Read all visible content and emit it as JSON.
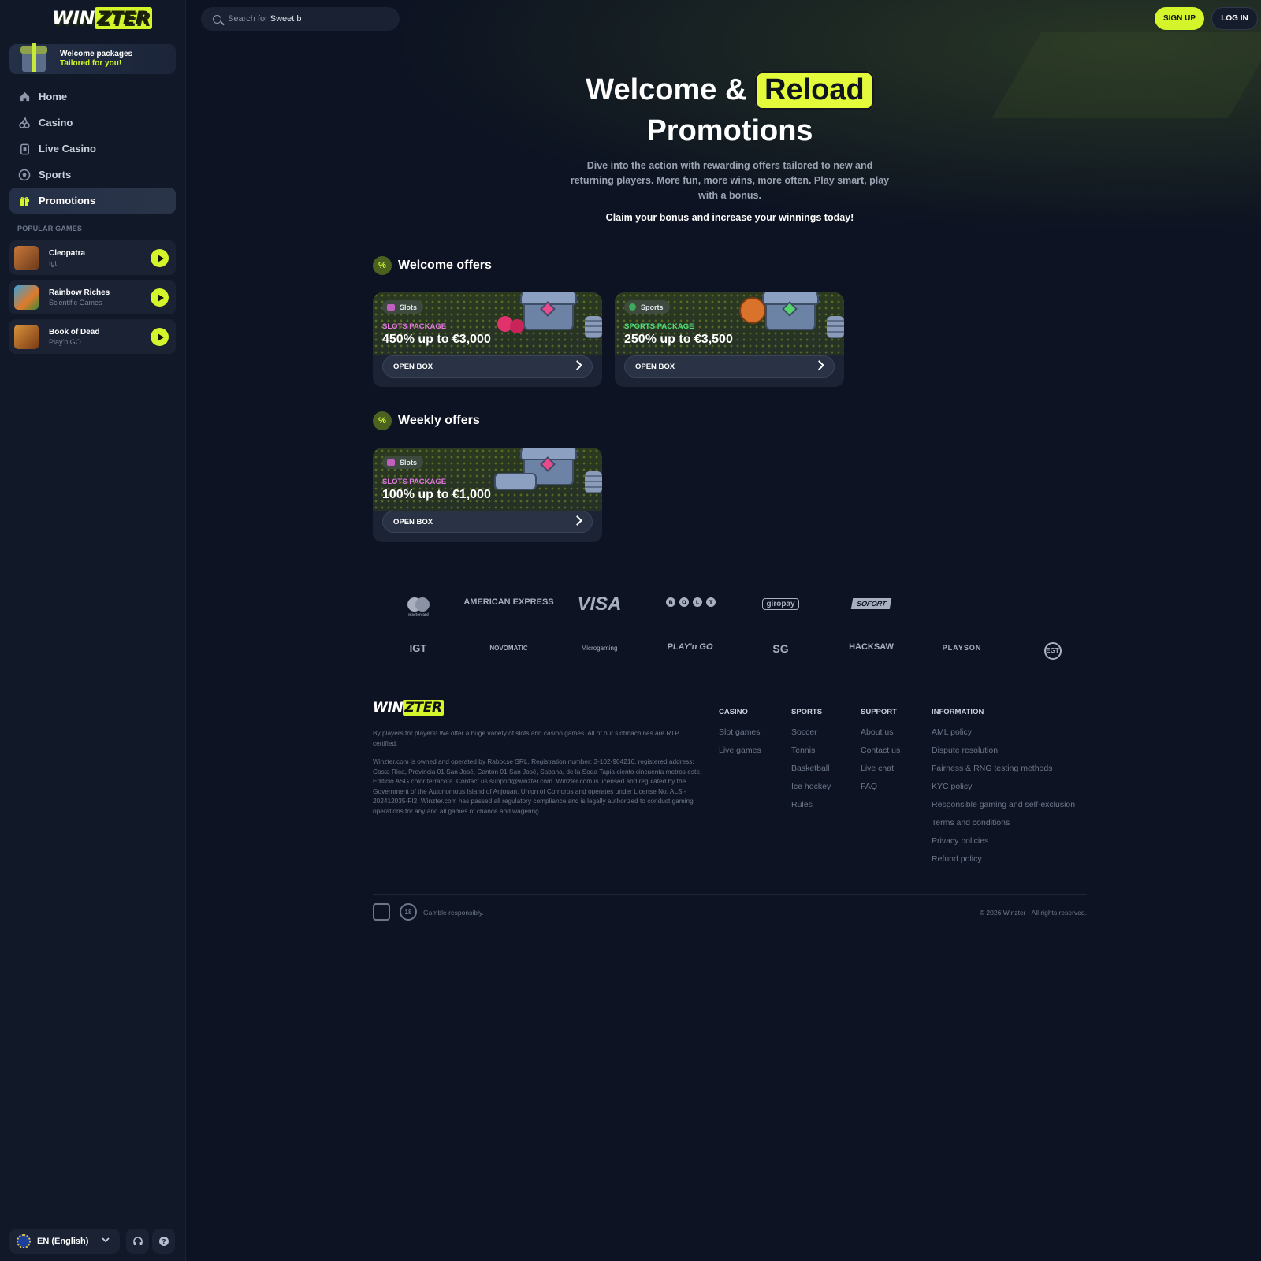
{
  "brand": {
    "logo_pre": "WIN",
    "logo_hl": "ZTER",
    "accent": "#d4f52a"
  },
  "sidebar": {
    "welcome": {
      "line1": "Welcome packages",
      "line2": "Tailored for you!"
    },
    "nav": [
      {
        "label": "Home",
        "icon": "home-icon"
      },
      {
        "label": "Casino",
        "icon": "cherries-icon"
      },
      {
        "label": "Live Casino",
        "icon": "cards-icon"
      },
      {
        "label": "Sports",
        "icon": "soccer-ball-icon"
      },
      {
        "label": "Promotions",
        "icon": "gift-icon",
        "active": true
      }
    ],
    "popular_title": "POPULAR GAMES",
    "games": [
      {
        "name": "Cleopatra",
        "provider": "Igt"
      },
      {
        "name": "Rainbow Riches",
        "provider": "Scientific Games"
      },
      {
        "name": "Book of Dead",
        "provider": "Play'n GO"
      }
    ],
    "language": "EN (English)"
  },
  "header": {
    "search_placeholder": "Search for",
    "search_typed": "Sweet b",
    "signup": "SIGN UP",
    "login": "LOG IN"
  },
  "hero": {
    "title_pre": "Welcome &",
    "title_hl": "Reload",
    "title_post": "Promotions",
    "description": "Dive into the action with rewarding offers tailored to new and returning players. More fun, more wins, more often. Play smart, play with a bonus.",
    "claim": "Claim your bonus and increase your winnings today!"
  },
  "sections": {
    "welcome_title": "Welcome offers",
    "weekly_title": "Weekly offers",
    "badge": "%"
  },
  "offers": [
    {
      "tag": "Slots",
      "package": "SLOTS PACKAGE",
      "amount": "450% up to €3,000",
      "cta": "OPEN BOX",
      "pkg_color": "#e277e0"
    },
    {
      "tag": "Sports",
      "package": "SPORTS PACKAGE",
      "amount": "250% up to €3,500",
      "cta": "OPEN BOX",
      "pkg_color": "#4ee07a"
    },
    {
      "tag": "Slots",
      "package": "SLOTS PACKAGE",
      "amount": "100% up to €1,000",
      "cta": "OPEN BOX",
      "pkg_color": "#e277e0"
    }
  ],
  "payments": [
    "mastercard",
    "AMERICAN EXPRESS",
    "VISA",
    "BOLT",
    "giropay",
    "SOFORT"
  ],
  "providers": [
    "IGT",
    "NOVOMATIC",
    "Microgaming",
    "PLAY'n GO",
    "SG",
    "HACKSAW",
    "PLAYSON",
    "EGT"
  ],
  "footer": {
    "about": "By players for players! We offer a huge variety of slots and casino games. All of our slotmachines are RTP certified.",
    "legal": "Winzter.com is owned and operated by Rabocse SRL. Registration number: 3-102-904216, registered address: Costa Rica, Provincia 01 San José, Cantón 01 San José, Sabana, de la Soda Tapia ciento cincuenta metros este, Edificio ASG color terracota. Contact us support@winzter.com. Winzter.com is licensed and regulated by the Government of the Autonomous Island of Anjouan, Union of Comoros and operates under License No. ALSI-202412035-FI2. Winzter.com has passed all regulatory compliance and is legally authorized to conduct gaming operations for any and all games of chance and wagering.",
    "columns": [
      {
        "title": "CASINO",
        "links": [
          "Slot games",
          "Live games"
        ]
      },
      {
        "title": "SPORTS",
        "links": [
          "Soccer",
          "Tennis",
          "Basketball",
          "Ice hockey",
          "Rules"
        ]
      },
      {
        "title": "SUPPORT",
        "links": [
          "About us",
          "Contact us",
          "Live chat",
          "FAQ"
        ]
      },
      {
        "title": "INFORMATION",
        "links": [
          "AML policy",
          "Dispute resolution",
          "Fairness & RNG testing methods",
          "KYC policy",
          "Responsible gaming and self-exclusion",
          "Terms and conditions",
          "Privacy policies",
          "Refund policy"
        ]
      }
    ],
    "age": "18",
    "gamble": "Gamble responsibly.",
    "copyright": "© 2026 Winzter - All rights reserved."
  }
}
